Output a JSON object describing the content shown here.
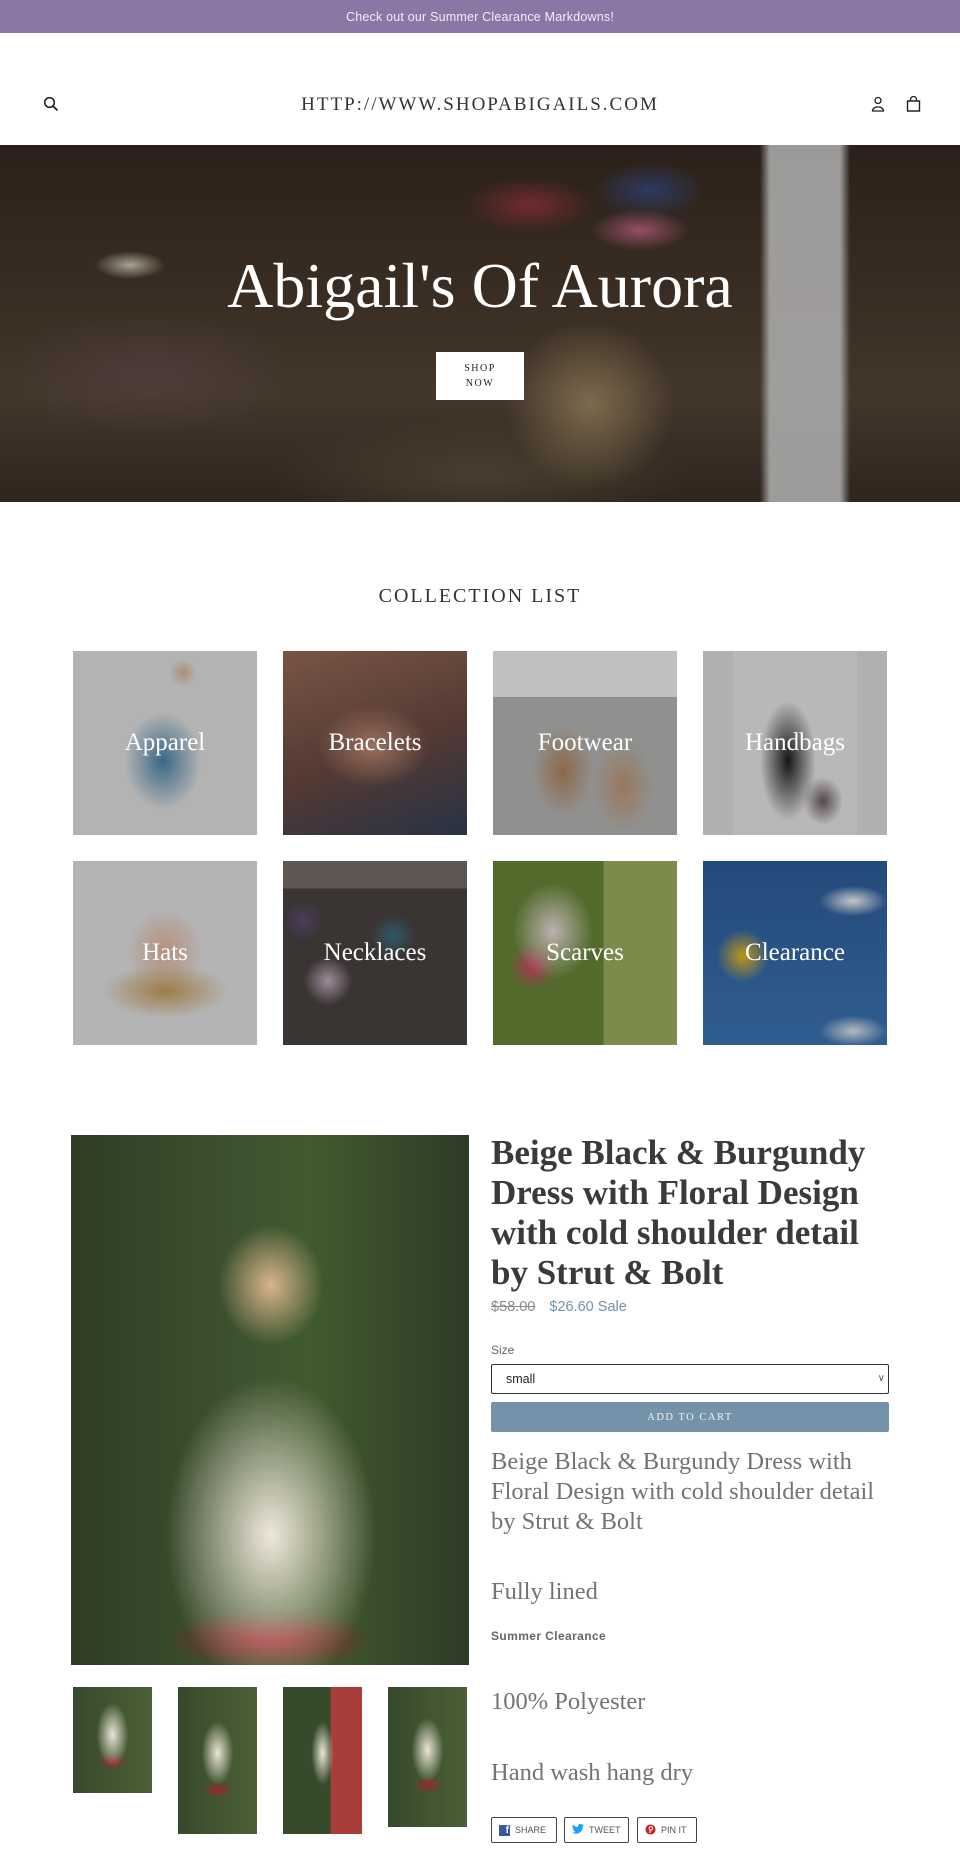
{
  "announcement": "Check out our Summer Clearance Markdowns!",
  "header": {
    "logo": "HTTP://WWW.SHOPABIGAILS.COM",
    "icons": [
      "search-icon",
      "account-icon",
      "cart-icon"
    ]
  },
  "hero": {
    "title": "Abigail's Of Aurora",
    "button_label": "SHOP NOW"
  },
  "collections": {
    "title": "COLLECTION LIST",
    "items": [
      {
        "label": "Apparel"
      },
      {
        "label": "Bracelets"
      },
      {
        "label": "Footwear"
      },
      {
        "label": "Handbags"
      },
      {
        "label": "Hats"
      },
      {
        "label": "Necklaces"
      },
      {
        "label": "Scarves"
      },
      {
        "label": "Clearance"
      }
    ]
  },
  "product": {
    "title": "Beige Black & Burgundy Dress with Floral Design with cold shoulder detail by Strut & Bolt",
    "price_regular": "$58.00",
    "price_sale": "$26.60",
    "sale_label": "Sale",
    "size_label": "Size",
    "size_selected": "small",
    "add_to_cart": "ADD TO CART",
    "description": [
      "Beige Black & Burgundy Dress with Floral Design with cold shoulder detail by Strut & Bolt",
      "Fully lined",
      "100% Polyester",
      "Hand wash hang dry"
    ],
    "tag": "Summer Clearance",
    "thumbnail_count": 4,
    "share": {
      "facebook": "SHARE",
      "twitter": "TWEET",
      "pinterest": "PIN IT"
    }
  },
  "colors": {
    "announcement_bg": "#8a77a6",
    "accent": "#7593a8",
    "sale_price": "#7193aa"
  }
}
